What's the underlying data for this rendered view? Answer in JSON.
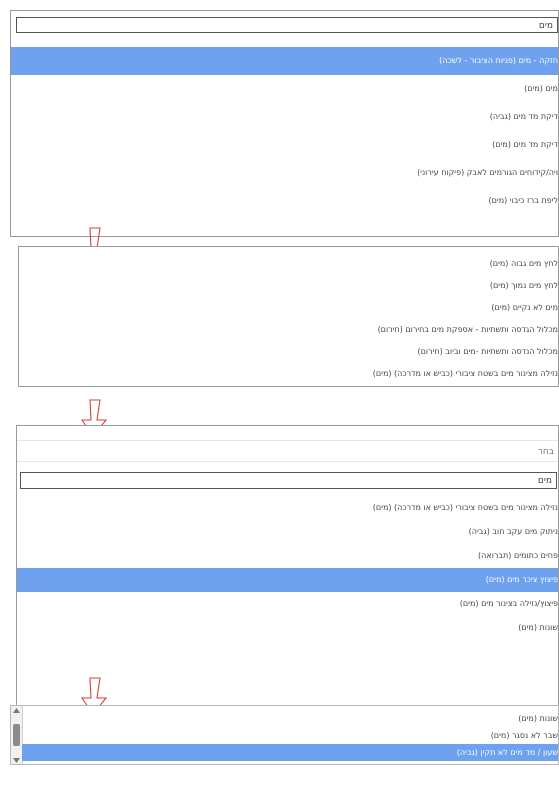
{
  "panel1": {
    "search_value": "מים",
    "items": [
      {
        "label": "חזקה - מים (פניות הציבור - לשכה)",
        "selected": true
      },
      {
        "label": "מים (מים)",
        "selected": false
      },
      {
        "label": "דיקת מד מים (גביה)",
        "selected": false
      },
      {
        "label": "דיקת מד מים (מים)",
        "selected": false
      },
      {
        "label": "ויה/קידוחים הגורמים לאבק (פיקוח עירוני)",
        "selected": false
      },
      {
        "label": "ליפת ברז כיבוי (מים)",
        "selected": false
      }
    ]
  },
  "panel2": {
    "items": [
      {
        "label": "לחץ מים גבוה (מים)",
        "selected": false
      },
      {
        "label": "לחץ מים נמוך (מים)",
        "selected": false
      },
      {
        "label": "מים לא נקיים (מים)",
        "selected": false
      },
      {
        "label": "מכלול הגדסה ותשתיות - אספקת מים בחירום (חירום)",
        "selected": false
      },
      {
        "label": "מכלול הנדסה ותשתיות -מים וביוב (חירום)",
        "selected": false
      },
      {
        "label": "נזילה מצינור מים בשטח ציבורי (כביש או מדרכה) (מים)",
        "selected": false
      }
    ]
  },
  "panel3": {
    "placeholder_text": "בחר",
    "search_value": "מים",
    "items": [
      {
        "label": "נזילה מצינור מים בשטח ציבורי (כביש או מדרכה) (מים)",
        "selected": false
      },
      {
        "label": "ניתוק מים עקב חוב (גביה)",
        "selected": false
      },
      {
        "label": "פחים כתומים (תברואה)",
        "selected": false
      },
      {
        "label": "פיצוץ ציכר מים (מים)",
        "selected": true
      },
      {
        "label": "פיצוץ/נזילה בצינור מים (מים)",
        "selected": false
      },
      {
        "label": "שונות (מים)",
        "selected": false
      }
    ]
  },
  "panel4": {
    "items": [
      {
        "label": "שונות (מים)",
        "selected": false
      },
      {
        "label": "שבר לא נסגר (מים)",
        "selected": false
      },
      {
        "label": "שעון / מד מים לא תקין (גביה)",
        "selected": true
      }
    ]
  },
  "icons": {
    "arrow": "down-arrow-icon",
    "scroll_up": "scroll-up-icon",
    "scroll_down": "scroll-down-icon"
  },
  "colors": {
    "selected_bg": "#6fa2ee",
    "arrow_stroke": "#d0453a"
  }
}
